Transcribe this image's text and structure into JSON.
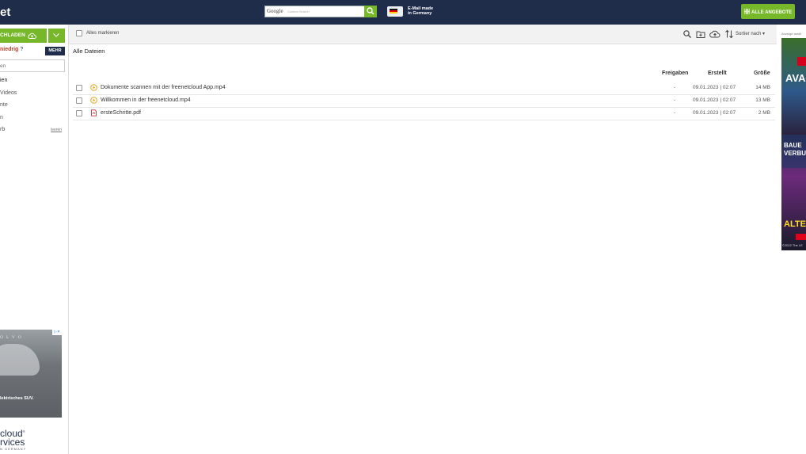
{
  "header": {
    "logo": "et",
    "search": {
      "label": "Google",
      "hint": "Custom Search"
    },
    "made_in": [
      "E-Mail made",
      "in Germany"
    ],
    "offers_label": "ALLE ANGEBOTE"
  },
  "sidebar": {
    "upload_label": "CHLADEN",
    "priority_label": "niedrig",
    "priority_help": "?",
    "more_label": "MEHR",
    "search_placeholder": "en",
    "items": [
      {
        "label": "ien",
        "active": true
      },
      {
        "label": "Videos"
      },
      {
        "label": "nte"
      },
      {
        "label": "n"
      },
      {
        "label": "rb",
        "action": "leeren"
      }
    ],
    "ad": {
      "brand": "OLVO",
      "tagline": "lektrisches SUV."
    },
    "logo": {
      "line1": "cloud",
      "line2": "rvices",
      "registered": "®",
      "sub": "N GERMANY"
    }
  },
  "toolbar": {
    "select_all_label": "Alles markieren",
    "sort_label": "Sortier nach"
  },
  "breadcrumb": "Alle Dateien",
  "columns": {
    "shares": "Freigaben",
    "created": "Erstellt",
    "size": "Größe"
  },
  "files": [
    {
      "name": "Dokumente scannen mit der freenetcloud App.mp4",
      "type": "video",
      "shares": "-",
      "created": "09.01.2023 | 02:07",
      "size": "14 MB"
    },
    {
      "name": "Willkommen in der freenetcloud.mp4",
      "type": "video",
      "shares": "-",
      "created": "09.01.2023 | 02:07",
      "size": "13 MB"
    },
    {
      "name": "ersteSchritte.pdf",
      "type": "pdf",
      "shares": "-",
      "created": "09.01.2023 | 02:07",
      "size": "2 MB"
    }
  ],
  "right_ad": {
    "label": "Anzeige ausbl",
    "title": "AVA",
    "subtitle": [
      "BAUE",
      "VERBU"
    ],
    "cta": "ALTE",
    "copyright": "©2022 The LE"
  },
  "colors": {
    "header_bg": "#1f2d4b",
    "accent_green": "#76b82a",
    "priority_red": "#c0392b"
  }
}
